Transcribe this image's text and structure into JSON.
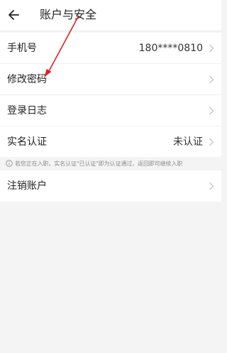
{
  "header": {
    "title": "账户与安全"
  },
  "settings": [
    {
      "label": "手机号",
      "value": "180****0810"
    },
    {
      "label": "修改密码",
      "value": ""
    },
    {
      "label": "登录日志",
      "value": ""
    },
    {
      "label": "实名认证",
      "value": "未认证"
    }
  ],
  "notice": {
    "text": "若您正在入职，实名认证\"已认证\"即为认证通过，返回即可继续入职"
  },
  "cancel_account": {
    "label": "注销账户"
  },
  "colors": {
    "annotation_arrow": "#e02020",
    "chevron": "#c4c4c4",
    "background": "#f4f4f4"
  },
  "icons": {
    "back": "arrow-left-icon",
    "chevron": "chevron-right-icon",
    "info": "info-circle-icon"
  }
}
